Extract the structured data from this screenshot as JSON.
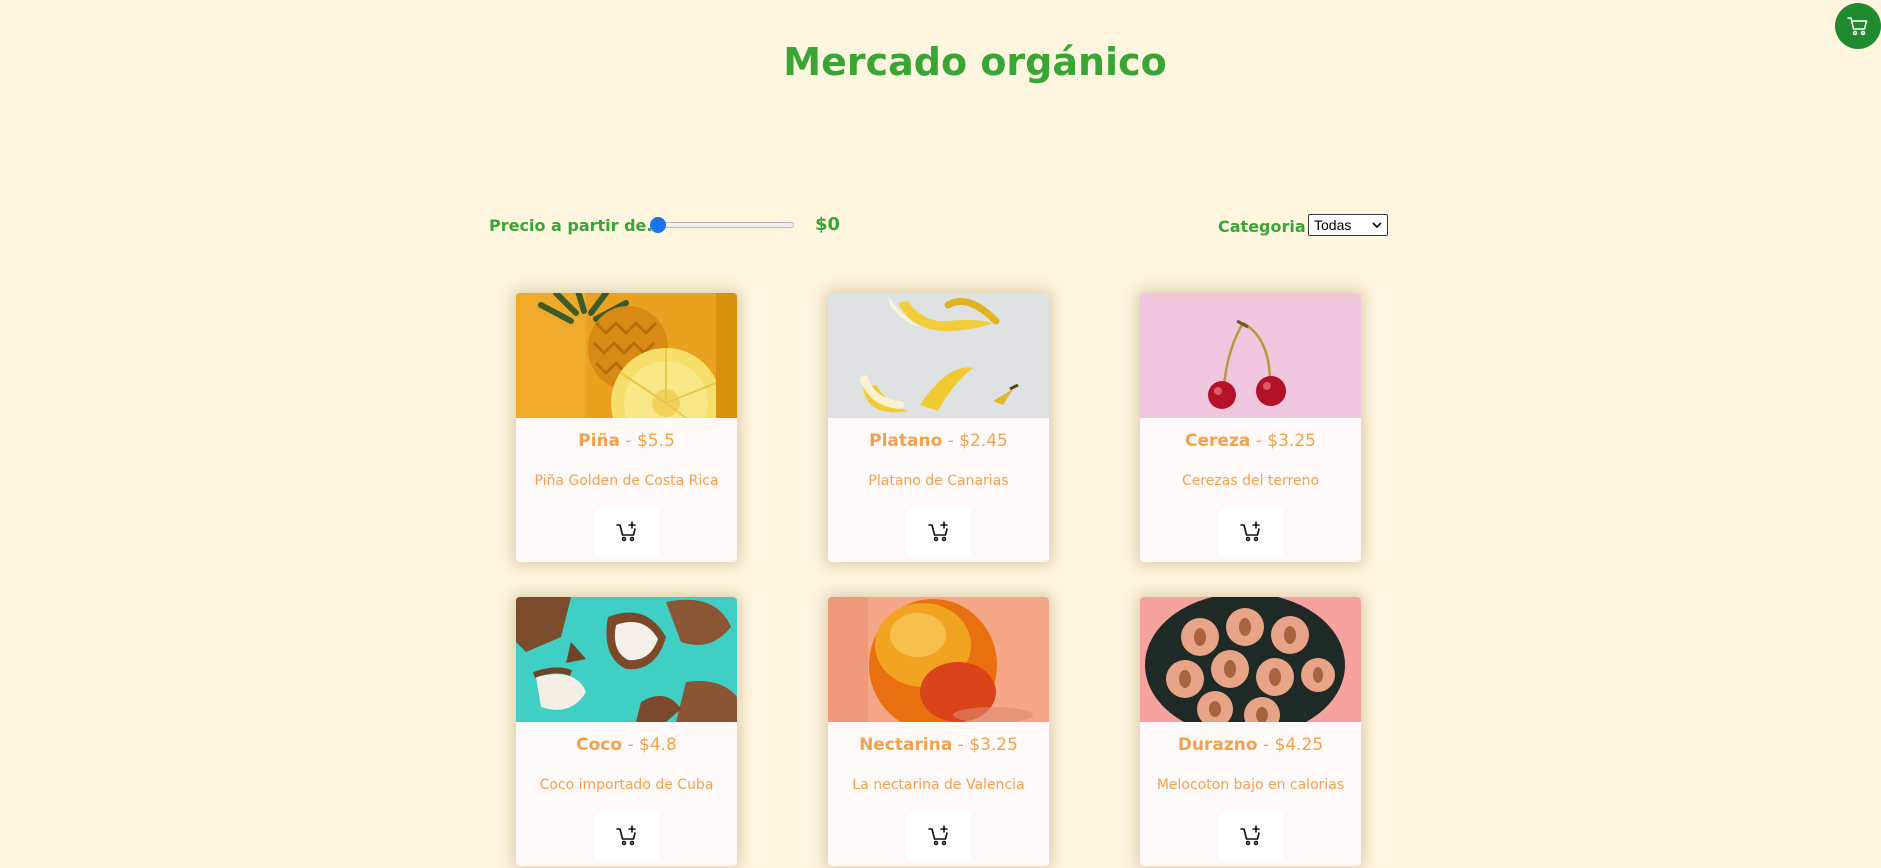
{
  "header": {
    "title": "Mercado orgánico",
    "cart_icon": "cart-icon"
  },
  "filters": {
    "price_label": "Precio a partir de...",
    "price_value": "$0",
    "price_slider_fraction": 0,
    "category_label": "Categoria",
    "category_selected": "Todas"
  },
  "colors": {
    "accent_green": "#3aa535",
    "cart_button": "#1f8a2e",
    "product_text": "#f3a14c",
    "background": "#fff6e0"
  },
  "products": [
    {
      "name": "Piña",
      "price": "$5.5",
      "description": "Piña Golden de Costa Rica",
      "image": "pineapple-image"
    },
    {
      "name": "Platano",
      "price": "$2.45",
      "description": "Platano de Canarias",
      "image": "banana-image"
    },
    {
      "name": "Cereza",
      "price": "$3.25",
      "description": "Cerezas del terreno",
      "image": "cherry-image"
    },
    {
      "name": "Coco",
      "price": "$4.8",
      "description": "Coco importado de Cuba",
      "image": "coconut-image"
    },
    {
      "name": "Nectarina",
      "price": "$3.25",
      "description": "La nectarina de Valencia",
      "image": "nectarine-image"
    },
    {
      "name": "Durazno",
      "price": "$4.25",
      "description": "Melocoton bajo en calorias",
      "image": "peach-image"
    }
  ],
  "card_button_icon": "add-to-cart-icon",
  "price_separator": " - "
}
